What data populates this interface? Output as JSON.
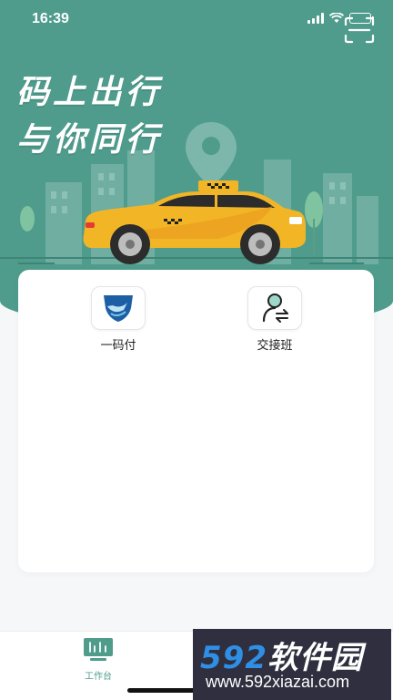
{
  "status_bar": {
    "time": "16:39"
  },
  "header": {
    "slogan_line1": "码上出行",
    "slogan_line2": "与你同行"
  },
  "icons": {
    "scan": "scan-icon",
    "pay": "shield-pay-icon",
    "shift": "person-swap-icon",
    "workbench": "workbench-icon"
  },
  "apps": [
    {
      "label": "一码付"
    },
    {
      "label": "交接班"
    }
  ],
  "tabbar": {
    "workbench_label": "工作台"
  },
  "watermark": {
    "logo_num": "592",
    "logo_text": "软件园",
    "url": "www.592xiazai.com"
  },
  "colors": {
    "brand": "#4f9c8d",
    "taxi": "#f2b526",
    "watermark_bg": "#2f2f3f",
    "watermark_num": "#2f8fe5"
  }
}
